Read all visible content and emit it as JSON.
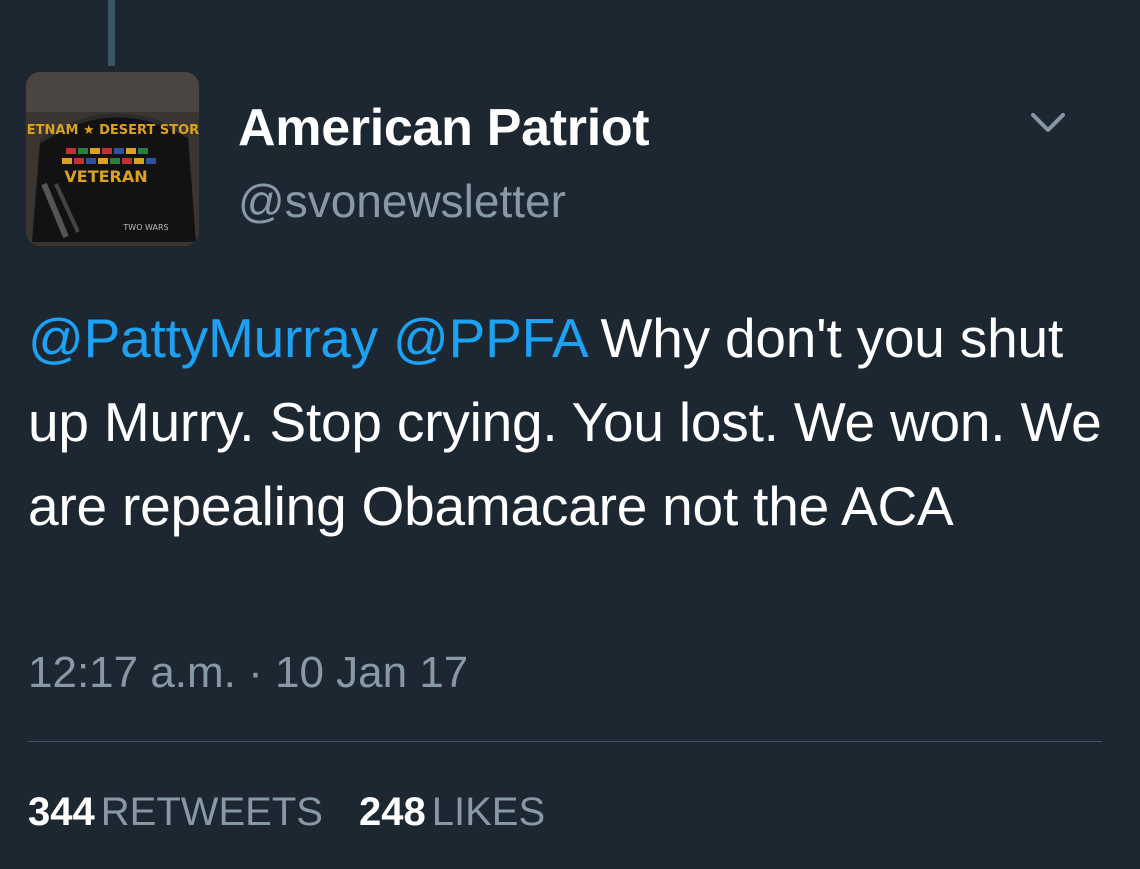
{
  "user": {
    "display_name": "American Patriot",
    "handle": "@svonewsletter",
    "avatar": {
      "description": "cap-icon",
      "cap_text_top": "VIETNAM ★ DESERT STORM",
      "cap_text_main": "VETERAN",
      "cap_text_bottom": "TWO WARS"
    }
  },
  "tweet": {
    "mention_1": "@PattyMurray",
    "mention_2": "@PPFA",
    "body": "Why don't you shut up Murry. Stop crying. You lost. We won. We are repealing Obamacare not the ACA",
    "timestamp": "12:17 a.m. · 10 Jan 17"
  },
  "stats": {
    "retweets_count": "344",
    "retweets_label": "RETWEETS",
    "likes_count": "248",
    "likes_label": "LIKES"
  },
  "icons": {
    "menu": "chevron-down-icon"
  },
  "colors": {
    "background": "#1c2732",
    "mention": "#1da1f2",
    "secondary_text": "#8899a6",
    "divider": "#3d5466"
  }
}
